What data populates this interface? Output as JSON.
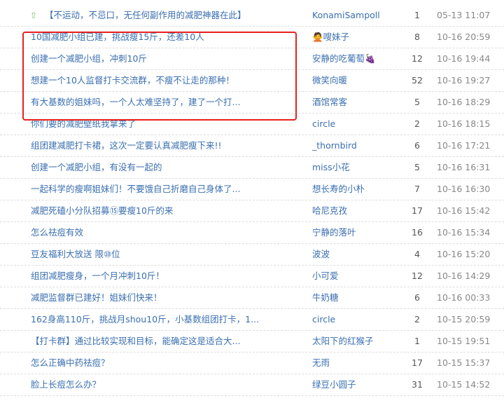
{
  "topics": [
    {
      "title": "【不运动，不忌口，无任何副作用的减肥神器在此】",
      "author": "KonamiSampoll",
      "replies": "1",
      "time": "05-13 11:07",
      "pinned": true
    },
    {
      "title": "10国减肥小组已建，挑战瘦15斤，还差10人",
      "author": "🙅嗖妹子",
      "replies": "8",
      "time": "10-16 20:59"
    },
    {
      "title": "创建一个减肥小组，冲刺10斤",
      "author": "安静的吃葡萄🍇",
      "replies": "12",
      "time": "10-16 19:44"
    },
    {
      "title": "想建一个10人监督打卡交流群，不瘦不让走的那种！",
      "author": "微笑向暖",
      "replies": "52",
      "time": "10-16 19:27"
    },
    {
      "title": "有大基数的姐妹吗，一个人太难坚持了，建了一个打...",
      "author": "酒馆常客",
      "replies": "5",
      "time": "10-16 18:29"
    },
    {
      "title": "你们要的减肥壁纸我拿来了",
      "author": "circle",
      "replies": "2",
      "time": "10-16 18:15"
    },
    {
      "title": "组团建减肥打卡裙，这次一定要认真减肥瘦下来!!",
      "author": "_thornbird",
      "replies": "6",
      "time": "10-16 17:21"
    },
    {
      "title": "创建一个减肥小组，有没有一起的",
      "author": "miss小花",
      "replies": "5",
      "time": "10-16 16:31"
    },
    {
      "title": "一起科学的瘦啊姐妹们！不要饿自己折磨自己身体了...",
      "author": "想长寿的小朴",
      "replies": "7",
      "time": "10-16 16:30"
    },
    {
      "title": "减肥死磕小分队招募⑮要瘦10斤的来",
      "author": "哈尼克孜",
      "replies": "17",
      "time": "10-16 15:42"
    },
    {
      "title": "怎么祛痘有效",
      "author": "宁静的落叶",
      "replies": "16",
      "time": "10-16 15:34"
    },
    {
      "title": "豆友福利大放送 限⑩位",
      "author": "波波",
      "replies": "4",
      "time": "10-16 15:20"
    },
    {
      "title": "组团减肥瘦身，一个月冲刺10斤！",
      "author": "小可爱",
      "replies": "12",
      "time": "10-16 14:29"
    },
    {
      "title": "减肥监督群已建好！姐妹们快来！",
      "author": "牛奶糖",
      "replies": "6",
      "time": "10-16 00:33"
    },
    {
      "title": "162身高110斤，挑战月shou10斤，小基数组团打卡，1...",
      "author": "circle",
      "replies": "2",
      "time": "10-15 20:59"
    },
    {
      "title": "【打卡群】通过比较实现和目标，能确定这是适合大...",
      "author": "太阳下的红猴子",
      "replies": "1",
      "time": "10-15 19:51"
    },
    {
      "title": "怎么正确中药祛痘？",
      "author": "无雨",
      "replies": "17",
      "time": "10-15 15:37"
    },
    {
      "title": "脸上长痘怎么办？",
      "author": "绿豆小圆子",
      "replies": "31",
      "time": "10-15 14:52"
    }
  ]
}
